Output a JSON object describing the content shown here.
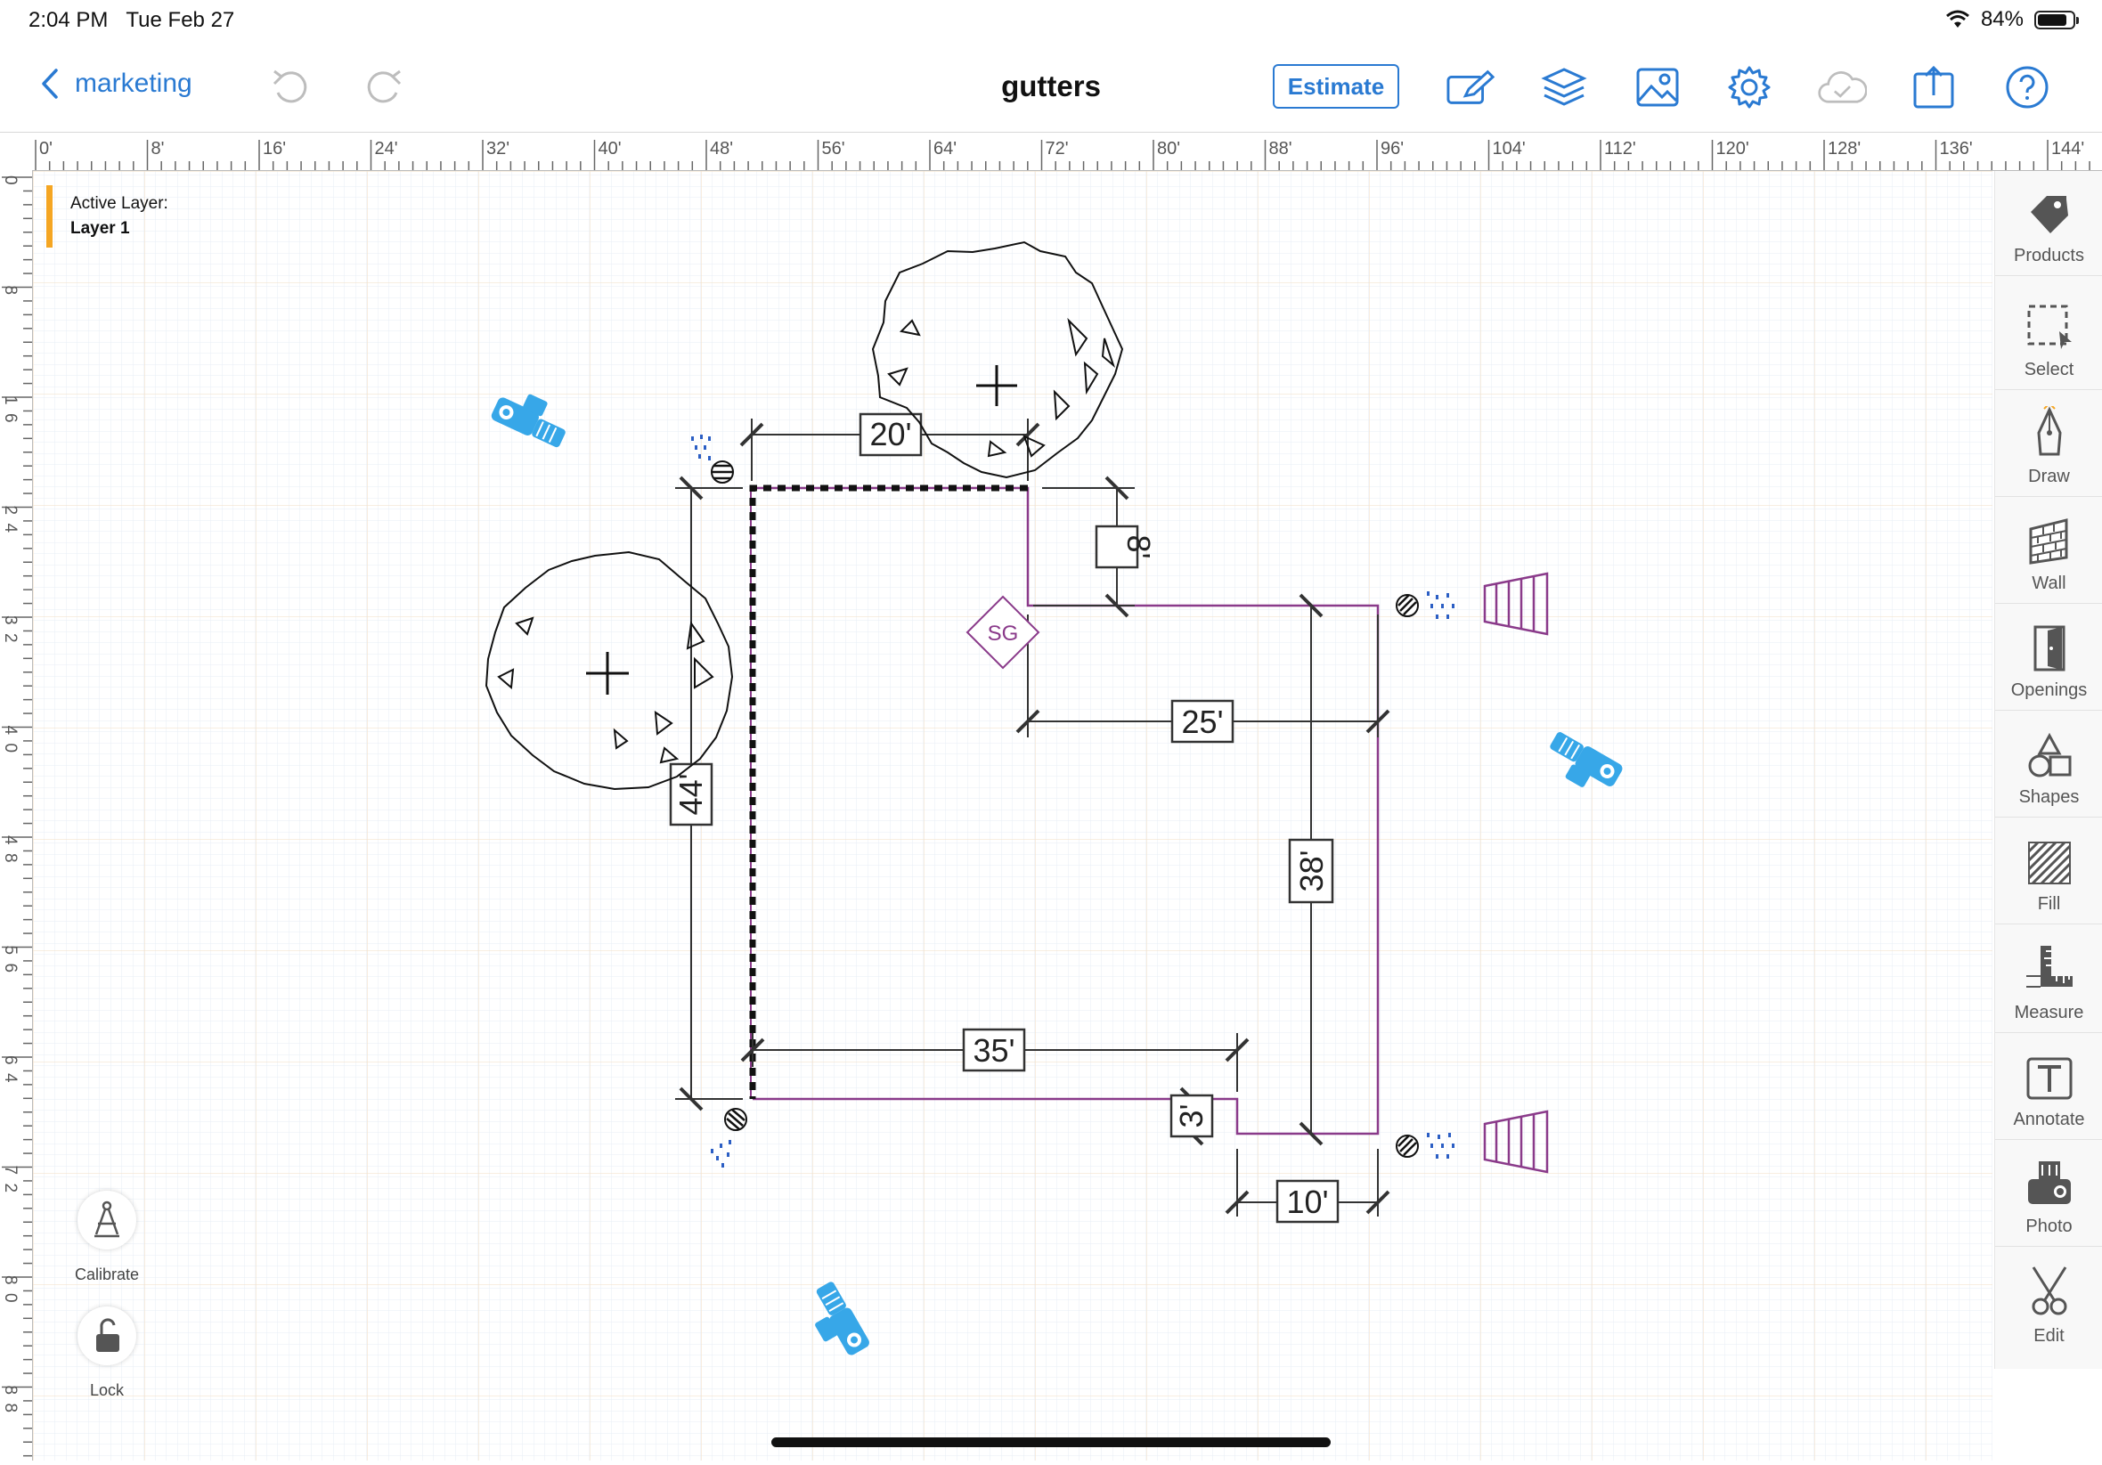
{
  "status_bar": {
    "time": "2:04 PM",
    "date": "Tue Feb 27",
    "battery": "84%",
    "battery_level": 0.84
  },
  "nav": {
    "back_label": "marketing",
    "title": "gutters",
    "estimate_label": "Estimate"
  },
  "ruler": {
    "top_ticks": [
      "0'",
      "8'",
      "16'",
      "24'",
      "32'",
      "40'",
      "48'",
      "56'",
      "64'",
      "72'",
      "80'",
      "88'",
      "96'",
      "104'",
      "112'",
      "120'",
      "128'",
      "136'",
      "144'"
    ],
    "left_ticks": [
      "0",
      "8",
      "16",
      "24",
      "32",
      "40",
      "48",
      "56",
      "64",
      "72",
      "80",
      "88"
    ]
  },
  "layer": {
    "caption": "Active Layer:",
    "name": "Layer 1"
  },
  "sidebar": {
    "products": "Products",
    "select": "Select",
    "draw": "Draw",
    "wall": "Wall",
    "openings": "Openings",
    "shapes": "Shapes",
    "fill": "Fill",
    "measure": "Measure",
    "annotate": "Annotate",
    "photo": "Photo",
    "edit": "Edit"
  },
  "controls": {
    "calibrate": "Calibrate",
    "lock": "Lock"
  },
  "drawing": {
    "dimensions": {
      "top": "20'",
      "right_step": "8'",
      "middle": "25'",
      "left": "44'",
      "right": "38'",
      "bottom": "35'",
      "small_step": "3'",
      "bottom_right": "10'"
    },
    "marker": "SG"
  },
  "colors": {
    "accent": "#2a7ad2",
    "layer_bar": "#f5a623",
    "gutter": "#8a3a8a",
    "marker_blue": "#37a7e8"
  }
}
